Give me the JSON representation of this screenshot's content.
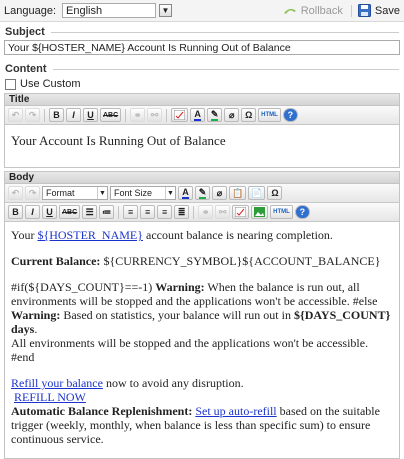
{
  "topbar": {
    "language_label": "Language:",
    "language_value": "English",
    "rollback_label": "Rollback",
    "save_label": "Save"
  },
  "subject": {
    "heading": "Subject",
    "value": "Your ${HOSTER_NAME} Account Is Running Out of Balance"
  },
  "content": {
    "heading": "Content",
    "use_custom_label": "Use Custom",
    "use_custom_checked": false
  },
  "title_editor": {
    "heading": "Title",
    "toolbar": [
      "undo-icon",
      "redo-icon",
      "bold",
      "italic",
      "underline",
      "strikethrough",
      "link-icon",
      "unlink-icon",
      "spellcheck-icon",
      "text-color-icon",
      "highlight-color-icon",
      "eraser-icon",
      "omega-icon",
      "html-icon",
      "help-icon"
    ],
    "toolbar_labels": {
      "bold": "B",
      "italic": "I",
      "underline": "U",
      "strike": "ABC",
      "omega": "Ω",
      "html": "HTML",
      "help": "?"
    },
    "text": "Your Account Is Running Out of Balance"
  },
  "body_editor": {
    "heading": "Body",
    "format_label": "Format",
    "font_size_label": "Font Size",
    "toolbar_labels": {
      "bold": "B",
      "italic": "I",
      "underline": "U",
      "strike": "ABC",
      "omega": "Ω",
      "html": "HTML",
      "help": "?"
    },
    "para1_pre": "Your ",
    "para1_link": "${HOSTER_NAME}",
    "para1_post": " account balance is nearing completion.",
    "balance_label": "Current Balance:",
    "balance_value": " ${CURRENCY_SYMBOL}${ACCOUNT_BALANCE}",
    "cond_if": "#if(${DAYS_COUNT}==-1) ",
    "warning_label": "Warning:",
    "cond_text1": " When the balance is run out, all environments will be stopped and the applications won't be accessible. #else ",
    "cond_text2": " Based on statistics, your balance will run out in ",
    "days_var": "${DAYS_COUNT} days",
    "cond_end": "All environments will be stopped and the applications won't be accessible. #end",
    "refill_link": "Refill your balance",
    "refill_post": " now to avoid any disruption.",
    "refill_now": "REFILL NOW",
    "auto_label": "Automatic Balance Replenishment:",
    "auto_link": "Set up auto-refill",
    "auto_post": " based on the suitable trigger (weekly, monthly, when balance is less than specific sum) to ensure continuous service."
  },
  "colors": {
    "link": "#1a33cc",
    "rollback_icon": "#8fc35b",
    "save_icon": "#3a6fc4"
  }
}
